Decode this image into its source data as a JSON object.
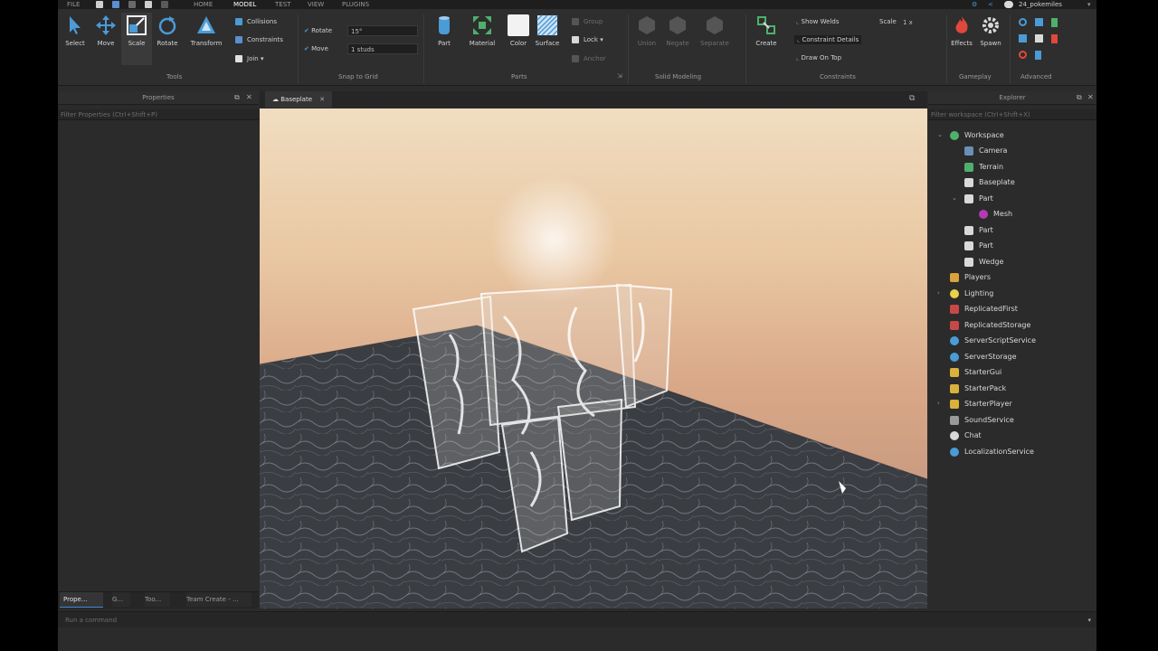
{
  "colors": {
    "accent": "#3b8bd6",
    "ribbon": "#2e2e2e",
    "panel": "#2b2b2b"
  },
  "menu": {
    "file": "FILE",
    "home": "HOME",
    "model": "MODEL",
    "test": "TEST",
    "view": "VIEW",
    "plugins": "PLUGINS",
    "user": "24_pokemiles"
  },
  "tools": {
    "select": "Select",
    "move": "Move",
    "scale": "Scale",
    "rotate": "Rotate",
    "transform": "Transform",
    "collisions": "Collisions",
    "constraints": "Constraints",
    "join": "Join",
    "group_label": "Tools"
  },
  "snap": {
    "rotate_label": "Rotate",
    "rotate_value": "15°",
    "move_label": "Move",
    "move_value": "1 studs",
    "group_label": "Snap to Grid"
  },
  "parts": {
    "part": "Part",
    "material": "Material",
    "color": "Color",
    "surface": "Surface",
    "group": "Group",
    "lock": "Lock",
    "anchor": "Anchor",
    "group_label": "Parts"
  },
  "solid": {
    "union": "Union",
    "negate": "Negate",
    "separate": "Separate",
    "group_label": "Solid Modeling"
  },
  "constraints_grp": {
    "create": "Create",
    "show_welds": "Show Welds",
    "constraint_details": "Constraint Details",
    "draw_on_top": "Draw On Top",
    "scale_label": "Scale",
    "scale_value": "1 x",
    "group_label": "Constraints"
  },
  "gameplay": {
    "effects": "Effects",
    "spawn": "Spawn",
    "group_label": "Gameplay"
  },
  "advanced": {
    "group_label": "Advanced"
  },
  "properties": {
    "title": "Properties",
    "filter_placeholder": "Filter Properties (Ctrl+Shift+P)"
  },
  "viewport": {
    "tab": "Baseplate"
  },
  "explorer": {
    "title": "Explorer",
    "filter_placeholder": "Filter workspace (Ctrl+Shift+X)",
    "items": [
      {
        "label": "Workspace",
        "icon": "workspace-icon",
        "color": "#4fb06b"
      },
      {
        "label": "Camera",
        "icon": "camera-icon",
        "color": "#6b8fb5"
      },
      {
        "label": "Terrain",
        "icon": "terrain-icon",
        "color": "#4fb06b"
      },
      {
        "label": "Baseplate",
        "icon": "part-icon",
        "color": "#d9d9d9"
      },
      {
        "label": "Part",
        "icon": "part-icon",
        "color": "#d9d9d9"
      },
      {
        "label": "Mesh",
        "icon": "mesh-icon",
        "color": "#b23bb2"
      },
      {
        "label": "Part",
        "icon": "part-icon",
        "color": "#d9d9d9"
      },
      {
        "label": "Part",
        "icon": "part-icon",
        "color": "#d9d9d9"
      },
      {
        "label": "Wedge",
        "icon": "wedge-icon",
        "color": "#d9d9d9"
      },
      {
        "label": "Players",
        "icon": "players-icon",
        "color": "#d9a23b"
      },
      {
        "label": "Lighting",
        "icon": "lighting-icon",
        "color": "#e8d24a"
      },
      {
        "label": "ReplicatedFirst",
        "icon": "replicated-first-icon",
        "color": "#c84848"
      },
      {
        "label": "ReplicatedStorage",
        "icon": "replicated-storage-icon",
        "color": "#c84848"
      },
      {
        "label": "ServerScriptService",
        "icon": "server-script-service-icon",
        "color": "#4a9bd6"
      },
      {
        "label": "ServerStorage",
        "icon": "server-storage-icon",
        "color": "#4a9bd6"
      },
      {
        "label": "StarterGui",
        "icon": "starter-gui-icon",
        "color": "#d9b13b"
      },
      {
        "label": "StarterPack",
        "icon": "starter-pack-icon",
        "color": "#d9b13b"
      },
      {
        "label": "StarterPlayer",
        "icon": "starter-player-icon",
        "color": "#d9b13b"
      },
      {
        "label": "SoundService",
        "icon": "sound-service-icon",
        "color": "#9a9a9a"
      },
      {
        "label": "Chat",
        "icon": "chat-icon",
        "color": "#d9d9d9"
      },
      {
        "label": "LocalizationService",
        "icon": "localization-service-icon",
        "color": "#4a9bd6"
      }
    ]
  },
  "bottom_tabs": {
    "properties": "Prope...",
    "game": "G...",
    "toolbox": "Too...",
    "team_create": "Team Create - ..."
  },
  "command": {
    "placeholder": "Run a command"
  }
}
